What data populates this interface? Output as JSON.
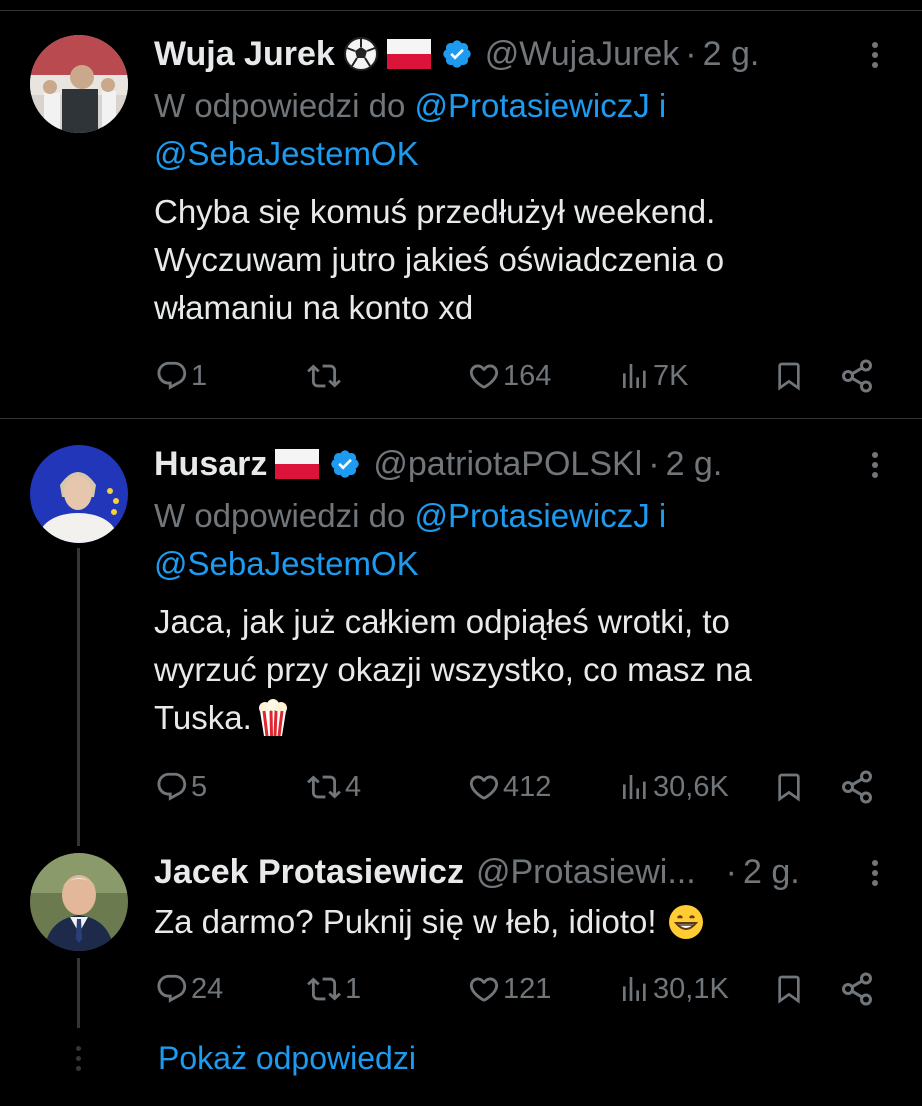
{
  "tweets": [
    {
      "name": "Wuja Jurek",
      "handle": "@WujaJurek",
      "sep": "·",
      "time": "2 g.",
      "reply_prefix": "W odpowiedzi do",
      "mention1": "@ProtasiewiczJ",
      "and": "i",
      "mention2": "@SebaJestemOK",
      "lines": [
        "Chyba się komuś przedłużył weekend.",
        "Wyczuwam jutro jakieś oświadczenia o",
        "włamaniu na konto xd"
      ],
      "replies": "1",
      "retweets": "",
      "likes": "164",
      "views": "7K"
    },
    {
      "name": "Husarz",
      "handle": "@patriotaPOLSKl",
      "sep": "·",
      "time": "2 g.",
      "reply_prefix": "W odpowiedzi do",
      "mention1": "@ProtasiewiczJ",
      "and": "i",
      "mention2": "@SebaJestemOK",
      "lines": [
        "Jaca, jak już całkiem odpiąłeś wrotki, to",
        "wyrzuć przy okazji wszystko, co masz na",
        "Tuska."
      ],
      "replies": "5",
      "retweets": "4",
      "likes": "412",
      "views": "30,6K"
    },
    {
      "name": "Jacek Protasiewicz",
      "handle": "@Protasiewi...",
      "sep": "·",
      "time": "2 g.",
      "lines": [
        "Za darmo? Puknij się w łeb, idioto!"
      ],
      "replies": "24",
      "retweets": "1",
      "likes": "121",
      "views": "30,1K"
    }
  ],
  "show_replies": "Pokaż odpowiedzi",
  "icons": {
    "verified": "verified-badge-icon",
    "reply": "reply-icon",
    "retweet": "retweet-icon",
    "like": "heart-icon",
    "views": "views-icon",
    "bookmark": "bookmark-icon",
    "share": "share-icon",
    "more": "more-icon",
    "soccer": "soccer-ball-emoji",
    "flag": "poland-flag-emoji",
    "popcorn": "popcorn-emoji",
    "grin": "grinning-face-emoji"
  },
  "colors": {
    "background": "#000000",
    "text": "#e7e9ea",
    "muted": "#71767b",
    "accent": "#1d9bf0",
    "verified": "#1d9bf0"
  }
}
